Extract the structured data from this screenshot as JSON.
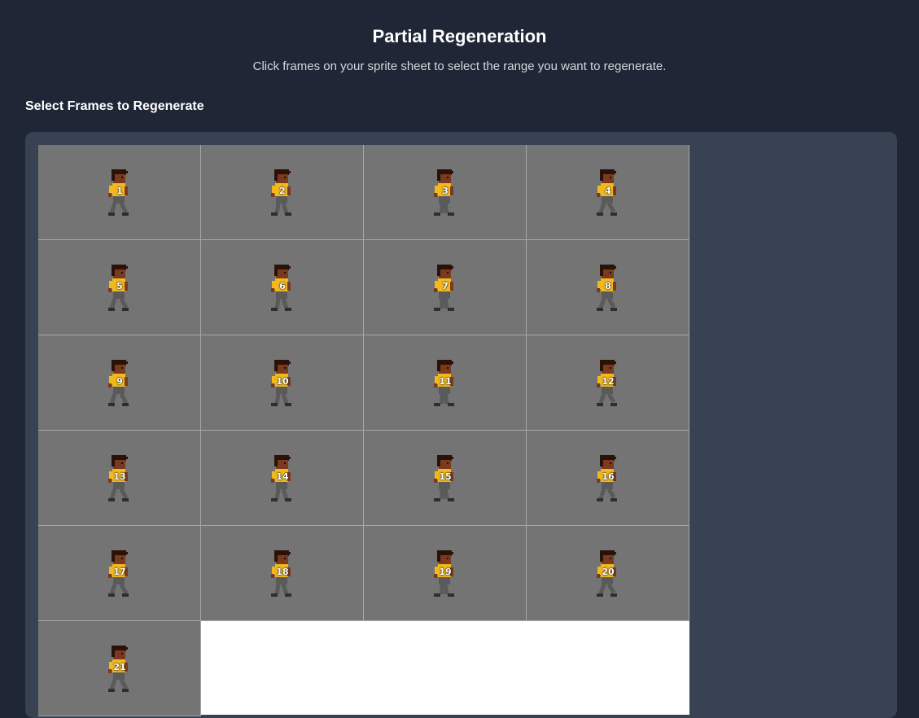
{
  "dialog": {
    "title": "Partial Regeneration",
    "subtitle": "Click frames on your sprite sheet to select the range you want to regenerate."
  },
  "section": {
    "label": "Select Frames to Regenerate"
  },
  "sprite_sheet": {
    "columns": 4,
    "frames": [
      "1",
      "2",
      "3",
      "4",
      "5",
      "6",
      "7",
      "8",
      "9",
      "10",
      "11",
      "12",
      "13",
      "14",
      "15",
      "16",
      "17",
      "18",
      "19",
      "20",
      "21"
    ]
  },
  "colors": {
    "shirt": "#f2b81c",
    "hair": "#2a1208",
    "skin": "#7a3a1e",
    "pants": "#5a5a5a",
    "shoes": "#2e2e2e"
  }
}
